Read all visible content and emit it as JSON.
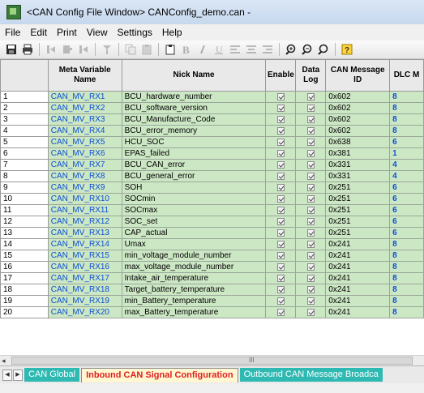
{
  "window": {
    "title": "<CAN Config File Window> CANConfig_demo.can -"
  },
  "menu": [
    "File",
    "Edit",
    "Print",
    "View",
    "Settings",
    "Help"
  ],
  "toolbar": {
    "icons": [
      "save-icon",
      "print-icon",
      "insert-row-icon",
      "add-row-icon",
      "delete-row-icon",
      "sort-icon",
      "copy-icon",
      "paste-icon",
      "clipboard-icon",
      "bold-icon",
      "italic-icon",
      "underline-icon",
      "align-left-icon",
      "align-center-icon",
      "align-right-icon",
      "zoom-icon",
      "zoom-out-icon",
      "search-icon",
      "help-icon"
    ]
  },
  "table": {
    "headers": {
      "meta": "Meta Variable Name",
      "nick": "Nick Name",
      "enable": "Enable",
      "datalog": "Data Log",
      "canid": "CAN Message ID",
      "dlc": "DLC M"
    },
    "rows": [
      {
        "n": "1",
        "meta": "CAN_MV_RX1",
        "nick": "BCU_hardware_number",
        "id": "0x602",
        "dlc": "8"
      },
      {
        "n": "2",
        "meta": "CAN_MV_RX2",
        "nick": "BCU_software_version",
        "id": "0x602",
        "dlc": "8"
      },
      {
        "n": "3",
        "meta": "CAN_MV_RX3",
        "nick": "BCU_Manufacture_Code",
        "id": "0x602",
        "dlc": "8"
      },
      {
        "n": "4",
        "meta": "CAN_MV_RX4",
        "nick": "BCU_error_memory",
        "id": "0x602",
        "dlc": "8"
      },
      {
        "n": "5",
        "meta": "CAN_MV_RX5",
        "nick": "HCU_SOC",
        "id": "0x638",
        "dlc": "6"
      },
      {
        "n": "6",
        "meta": "CAN_MV_RX6",
        "nick": "EPAS_failed",
        "id": "0x381",
        "dlc": "1"
      },
      {
        "n": "7",
        "meta": "CAN_MV_RX7",
        "nick": "BCU_CAN_error",
        "id": "0x331",
        "dlc": "4"
      },
      {
        "n": "8",
        "meta": "CAN_MV_RX8",
        "nick": "BCU_general_error",
        "id": "0x331",
        "dlc": "4"
      },
      {
        "n": "9",
        "meta": "CAN_MV_RX9",
        "nick": "SOH",
        "id": "0x251",
        "dlc": "6"
      },
      {
        "n": "10",
        "meta": "CAN_MV_RX10",
        "nick": "SOCmin",
        "id": "0x251",
        "dlc": "6"
      },
      {
        "n": "11",
        "meta": "CAN_MV_RX11",
        "nick": "SOCmax",
        "id": "0x251",
        "dlc": "6"
      },
      {
        "n": "12",
        "meta": "CAN_MV_RX12",
        "nick": "SOC_set",
        "id": "0x251",
        "dlc": "6"
      },
      {
        "n": "13",
        "meta": "CAN_MV_RX13",
        "nick": "CAP_actual",
        "id": "0x251",
        "dlc": "6"
      },
      {
        "n": "14",
        "meta": "CAN_MV_RX14",
        "nick": "Umax",
        "id": "0x241",
        "dlc": "8"
      },
      {
        "n": "15",
        "meta": "CAN_MV_RX15",
        "nick": "min_voltage_module_number",
        "id": "0x241",
        "dlc": "8"
      },
      {
        "n": "16",
        "meta": "CAN_MV_RX16",
        "nick": "max_voltage_module_number",
        "id": "0x241",
        "dlc": "8"
      },
      {
        "n": "17",
        "meta": "CAN_MV_RX17",
        "nick": "Intake_air_temperature",
        "id": "0x241",
        "dlc": "8"
      },
      {
        "n": "18",
        "meta": "CAN_MV_RX18",
        "nick": "Target_battery_temperature",
        "id": "0x241",
        "dlc": "8"
      },
      {
        "n": "19",
        "meta": "CAN_MV_RX19",
        "nick": "min_Battery_temperature",
        "id": "0x241",
        "dlc": "8"
      },
      {
        "n": "20",
        "meta": "CAN_MV_RX20",
        "nick": "max_Battery_temperature",
        "id": "0x241",
        "dlc": "8"
      }
    ]
  },
  "scrollbar": {
    "grip": "III"
  },
  "tabs": {
    "global": "CAN Global",
    "inbound": "Inbound CAN Signal Configuration",
    "outbound": "Outbound CAN Message Broadca"
  },
  "colors": {
    "cell_green": "#cce7c4",
    "link_blue": "#0b4fd6",
    "tab_teal": "#2fb9b3",
    "active_tab_red": "#e01e1e"
  }
}
